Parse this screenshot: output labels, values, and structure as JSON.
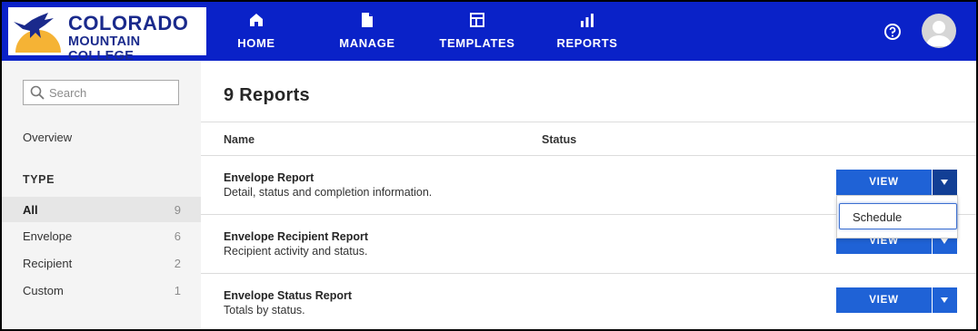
{
  "header": {
    "logo": {
      "line1": "COLORADO",
      "line2": "MOUNTAIN COLLEGE"
    },
    "nav": [
      {
        "label": "HOME",
        "icon": "home-icon"
      },
      {
        "label": "MANAGE",
        "icon": "document-icon"
      },
      {
        "label": "TEMPLATES",
        "icon": "template-icon"
      },
      {
        "label": "REPORTS",
        "icon": "bar-chart-icon"
      }
    ],
    "help_icon": "help-icon",
    "avatar_icon": "user-avatar-icon"
  },
  "sidebar": {
    "search": {
      "placeholder": "Search",
      "value": ""
    },
    "overview_label": "Overview",
    "type_heading": "TYPE",
    "types": [
      {
        "label": "All",
        "count": "9",
        "active": true
      },
      {
        "label": "Envelope",
        "count": "6",
        "active": false
      },
      {
        "label": "Recipient",
        "count": "2",
        "active": false
      },
      {
        "label": "Custom",
        "count": "1",
        "active": false
      }
    ]
  },
  "main": {
    "title": "9 Reports",
    "columns": {
      "name": "Name",
      "status": "Status"
    },
    "reports": [
      {
        "name": "Envelope Report",
        "description": "Detail, status and completion information.",
        "action": "VIEW"
      },
      {
        "name": "Envelope Recipient Report",
        "description": "Recipient activity and status.",
        "action": "VIEW"
      },
      {
        "name": "Envelope Status Report",
        "description": "Totals by status.",
        "action": "VIEW"
      }
    ],
    "dropdown": {
      "items": [
        "Schedule"
      ]
    }
  },
  "colors": {
    "header_bg": "#0a22c8",
    "button_primary": "#1f62d6",
    "button_caret_open": "#123f95",
    "sidebar_bg": "#f4f4f4",
    "logo_text": "#1a2a8c",
    "logo_sun": "#f5b335"
  }
}
